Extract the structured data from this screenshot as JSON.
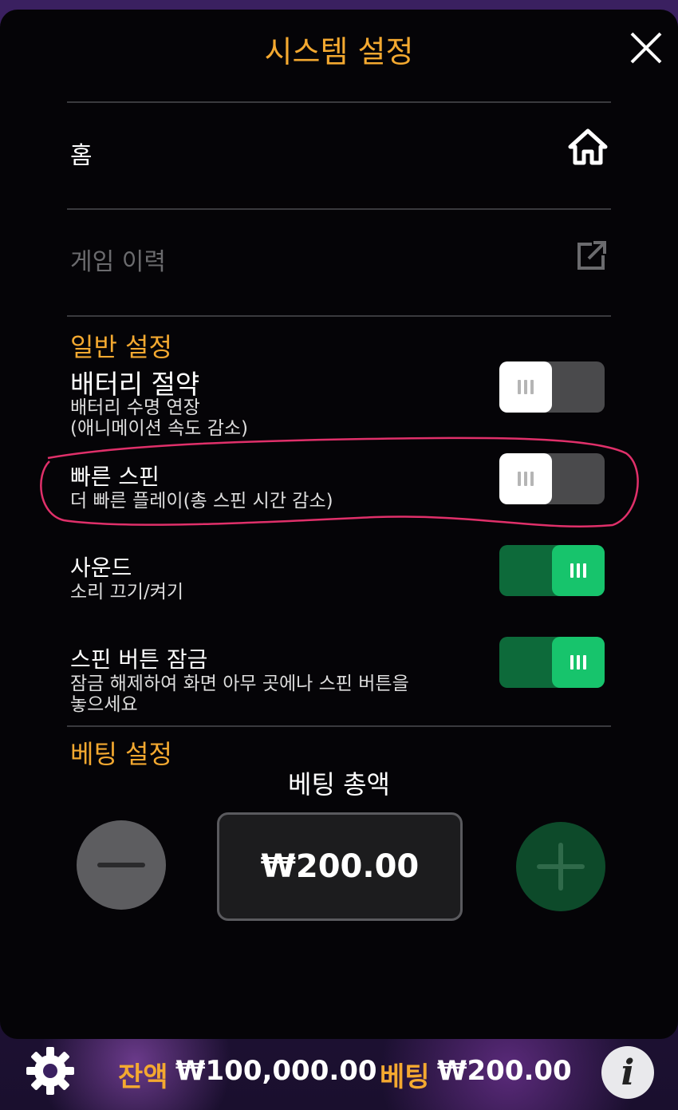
{
  "header": {
    "title": "시스템 설정"
  },
  "menu": {
    "home_label": "홈",
    "history_label": "게임 이력"
  },
  "general": {
    "section_title": "일반 설정",
    "battery": {
      "title": "배터리 절약",
      "desc_line1": "배터리 수명 연장",
      "desc_line2": "(애니메이션 속도 감소)",
      "enabled": false
    },
    "fast_spin": {
      "title": "빠른 스핀",
      "desc": "더 빠른 플레이(총 스핀 시간 감소)",
      "enabled": false
    },
    "sound": {
      "title": "사운드",
      "desc": "소리 끄기/켜기",
      "enabled": true
    },
    "spin_lock": {
      "title": "스핀 버튼 잠금",
      "desc_line1": "잠금 해제하여 화면 아무 곳에나 스핀 버튼을",
      "desc_line2": "놓으세요",
      "enabled": true
    }
  },
  "betting": {
    "section_title": "베팅 설정",
    "total_label": "베팅 총액",
    "total_value": "₩200.00"
  },
  "footer": {
    "balance_label": "잔액",
    "balance_value": "₩100,000.00",
    "bet_label": "베팅",
    "bet_value": "₩200.00",
    "info_glyph": "i"
  },
  "colors": {
    "accent": "#f4a930",
    "toggle_on": "#17c46c",
    "annotation": "#e0306a"
  }
}
